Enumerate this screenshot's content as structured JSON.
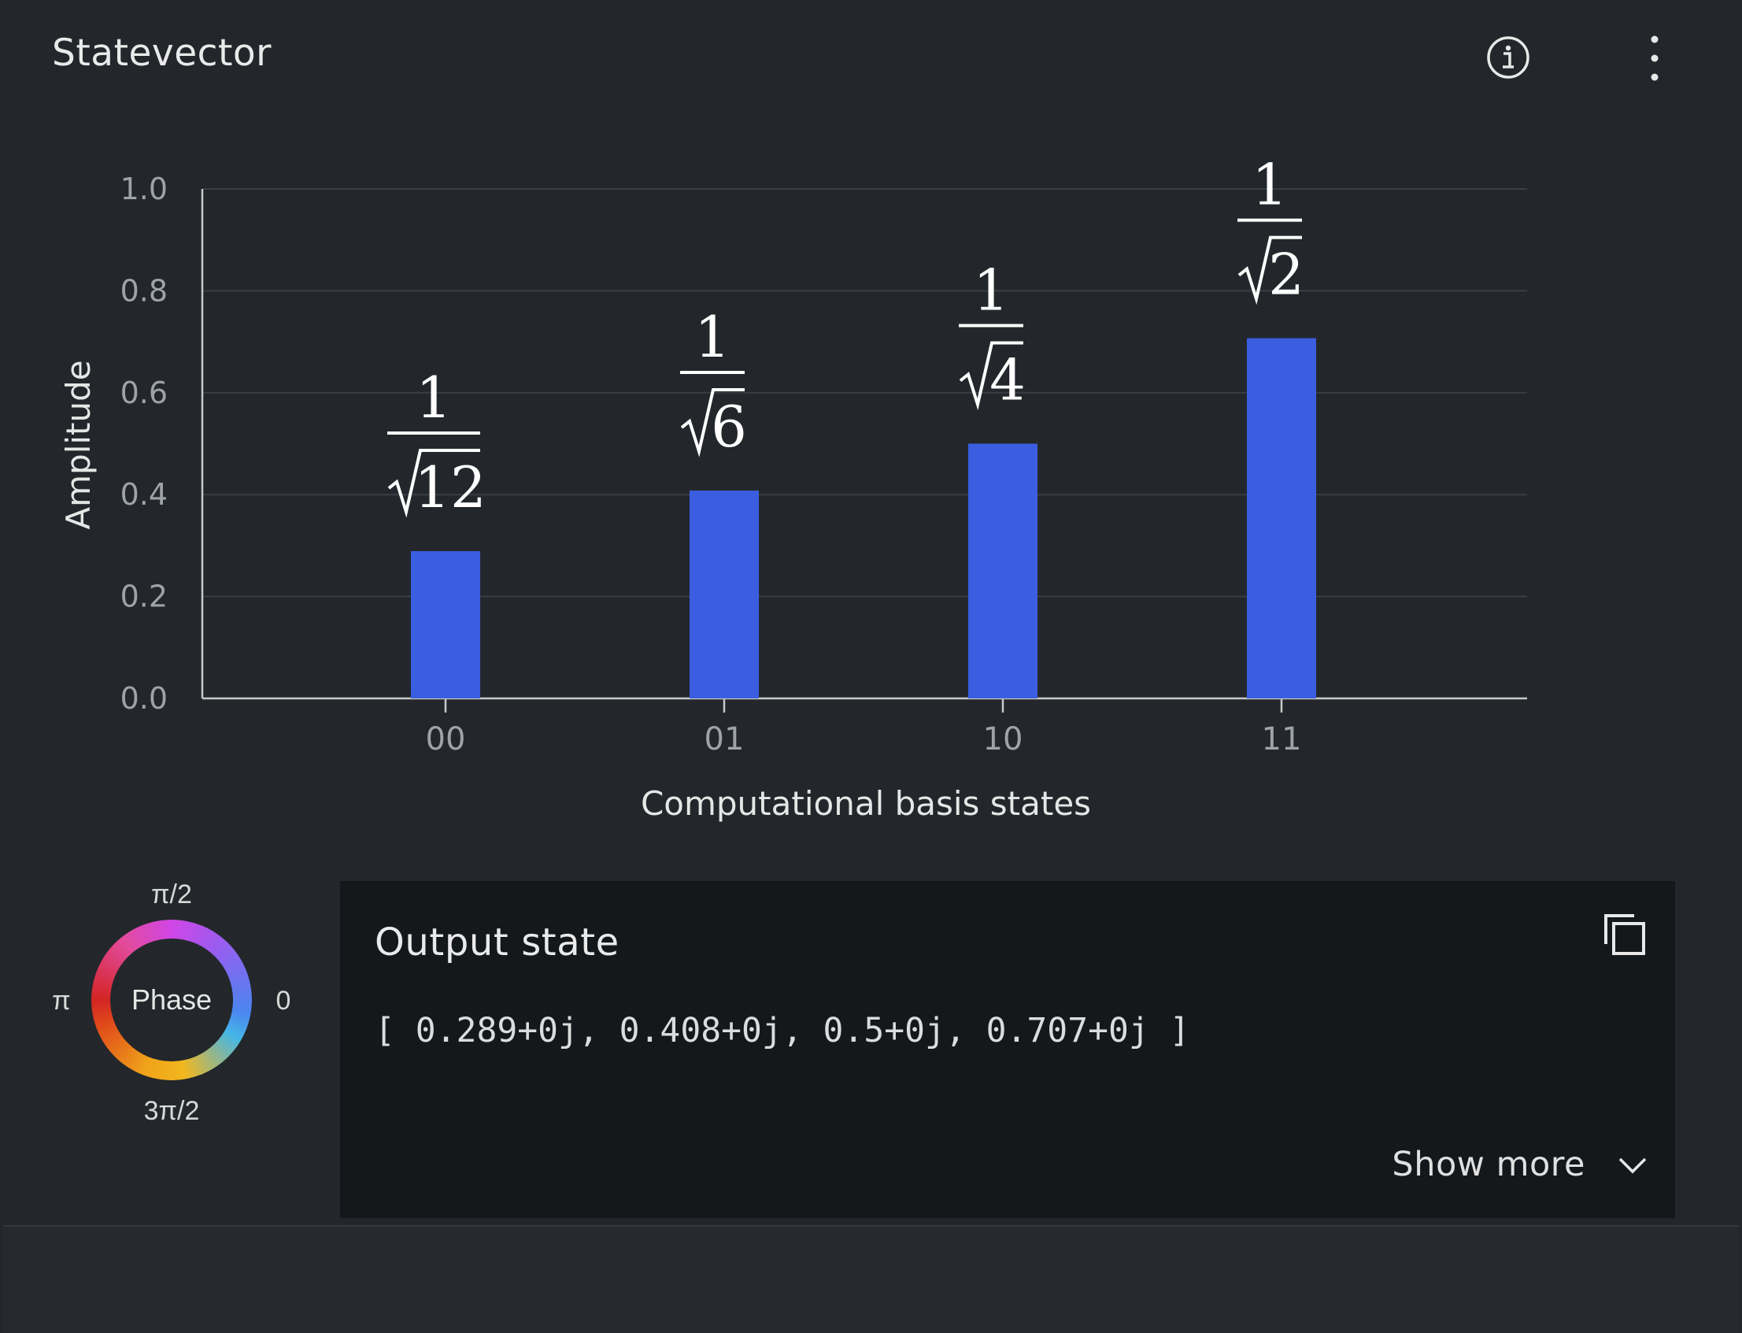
{
  "header": {
    "title": "Statevector",
    "info_icon": "info-circle-icon",
    "menu_icon": "overflow-menu-vertical-icon"
  },
  "chart_data": {
    "type": "bar",
    "categories": [
      "00",
      "01",
      "10",
      "11"
    ],
    "values": [
      0.289,
      0.408,
      0.5,
      0.707
    ],
    "bar_labels": [
      {
        "numerator": "1",
        "radicand": "12"
      },
      {
        "numerator": "1",
        "radicand": "6"
      },
      {
        "numerator": "1",
        "radicand": "4"
      },
      {
        "numerator": "1",
        "radicand": "2"
      }
    ],
    "xlabel": "Computational basis states",
    "ylabel": "Amplitude",
    "ylim": [
      0,
      1.0
    ],
    "yticks": [
      "0.0",
      "0.2",
      "0.4",
      "0.6",
      "0.8",
      "1.0"
    ],
    "grid": true,
    "bar_color": "#3b5ee0"
  },
  "phase_legend": {
    "center_label": "Phase",
    "top_label": "π/2",
    "left_label": "π",
    "right_label": "0",
    "bottom_label": "3π/2"
  },
  "output": {
    "title": "Output state",
    "value": "[ 0.289+0j, 0.408+0j, 0.5+0j, 0.707+0j ]",
    "copy_icon": "copy-icon",
    "show_more_label": "Show more",
    "chevron_icon": "chevron-down-icon"
  }
}
